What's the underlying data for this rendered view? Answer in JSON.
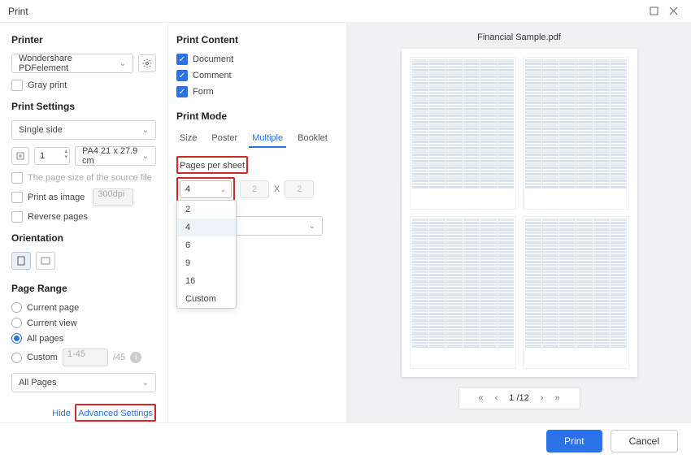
{
  "window_title": "Print",
  "left": {
    "printer_heading": "Printer",
    "printer_value": "Wondershare PDFelement",
    "gray_print": "Gray print",
    "settings_heading": "Print Settings",
    "sides": "Single side",
    "copies": "1",
    "paper": "PA4 21 x 27.9 cm",
    "source_note": "The page size of the source file",
    "print_as_image": "Print as image",
    "dpi_placeholder": "300dpi",
    "reverse_pages": "Reverse pages",
    "orientation_heading": "Orientation",
    "page_range_heading": "Page Range",
    "range_current_page": "Current page",
    "range_current_view": "Current view",
    "range_all_pages": "All pages",
    "range_custom": "Custom",
    "custom_placeholder": "1-45",
    "custom_total": "/45",
    "subset": "All Pages",
    "hide_label": "Hide",
    "advanced_label": "Advanced Settings"
  },
  "mid": {
    "content_heading": "Print Content",
    "document": "Document",
    "comment": "Comment",
    "form": "Form",
    "mode_heading": "Print Mode",
    "tab_size": "Size",
    "tab_poster": "Poster",
    "tab_multiple": "Multiple",
    "tab_booklet": "Booklet",
    "pps_label": "Pages per sheet",
    "pps_value": "4",
    "grid_cols": "2",
    "grid_sep": "X",
    "grid_rows": "2",
    "options": [
      "2",
      "4",
      "6",
      "9",
      "16",
      "Custom"
    ]
  },
  "right": {
    "filename": "Financial Sample.pdf",
    "page_indicator": "1 /12"
  },
  "footer": {
    "print": "Print",
    "cancel": "Cancel"
  }
}
